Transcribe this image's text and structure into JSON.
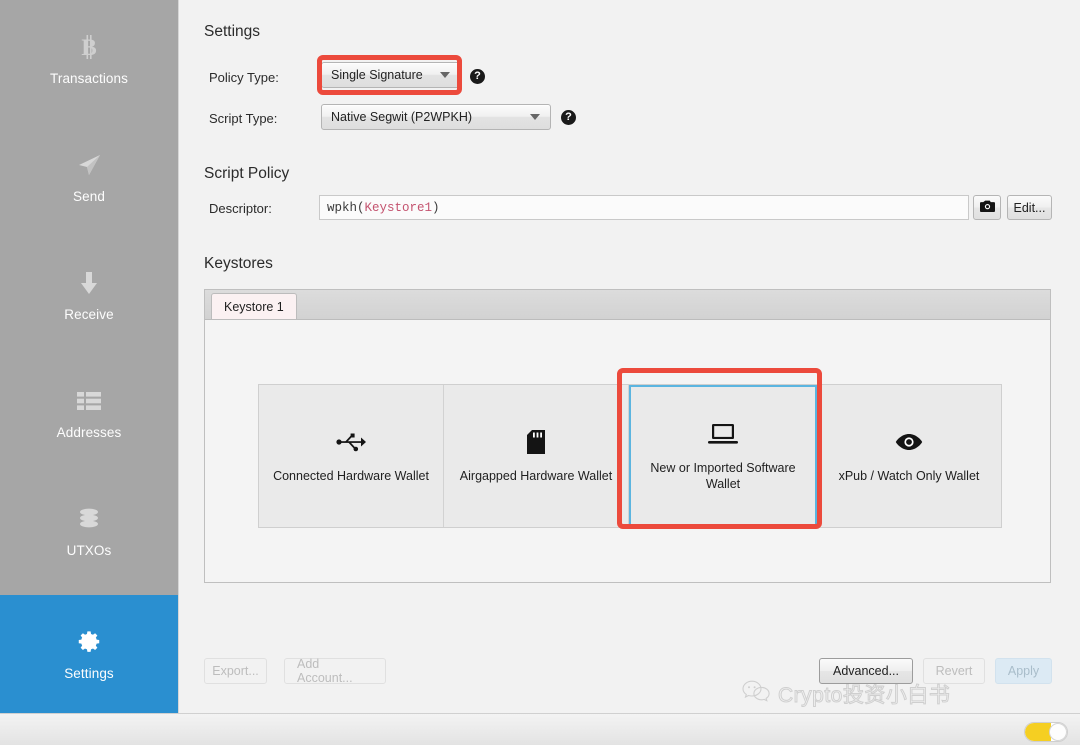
{
  "sidebar": {
    "items": [
      {
        "label": "Transactions",
        "icon": "bitcoin-icon",
        "active": false
      },
      {
        "label": "Send",
        "icon": "send-icon",
        "active": false
      },
      {
        "label": "Receive",
        "icon": "receive-icon",
        "active": false
      },
      {
        "label": "Addresses",
        "icon": "list-icon",
        "active": false
      },
      {
        "label": "UTXOs",
        "icon": "coins-icon",
        "active": false
      },
      {
        "label": "Settings",
        "icon": "gear-icon",
        "active": true
      }
    ],
    "active_color": "#2a8fd0",
    "background_color": "#a6a6a6"
  },
  "main": {
    "settings_title": "Settings",
    "policy_type": {
      "label": "Policy Type:",
      "value": "Single Signature",
      "help": "?"
    },
    "script_type": {
      "label": "Script Type:",
      "value": "Native Segwit (P2WPKH)",
      "help": "?"
    },
    "script_policy": {
      "title": "Script Policy",
      "descriptor_label": "Descriptor:",
      "descriptor_prefix": "wpkh(",
      "descriptor_key": "Keystore1",
      "descriptor_suffix": ")",
      "key_color": "#c4536f",
      "camera_button": "camera-icon",
      "edit_button": "Edit..."
    },
    "keystores": {
      "title": "Keystores",
      "tabs": [
        {
          "label": "Keystore 1",
          "active": true
        }
      ],
      "cards": [
        {
          "label": "Connected Hardware Wallet",
          "icon": "usb-icon",
          "selected": false
        },
        {
          "label": "Airgapped Hardware Wallet",
          "icon": "sdcard-icon",
          "selected": false
        },
        {
          "label": "New or Imported Software Wallet",
          "icon": "laptop-icon",
          "selected": true
        },
        {
          "label": "xPub / Watch Only Wallet",
          "icon": "eye-icon",
          "selected": false
        }
      ]
    },
    "footer": {
      "export_label": "Export...",
      "export_enabled": false,
      "add_account_label": "Add Account...",
      "add_account_enabled": false,
      "advanced_label": "Advanced...",
      "advanced_enabled": true,
      "revert_label": "Revert",
      "revert_enabled": false,
      "apply_label": "Apply",
      "apply_enabled": false
    }
  },
  "annotations": {
    "highlight_color": "#ec4a3c",
    "focus_color": "#5bb5e0",
    "boxes": [
      "policy-type-combo",
      "software-wallet-card"
    ]
  },
  "watermark": {
    "text": "Crypto投资小白书",
    "icon": "wechat-icon"
  },
  "statusbar": {
    "theme_toggle_state": "on",
    "toggle_color": "#f5cf22"
  }
}
